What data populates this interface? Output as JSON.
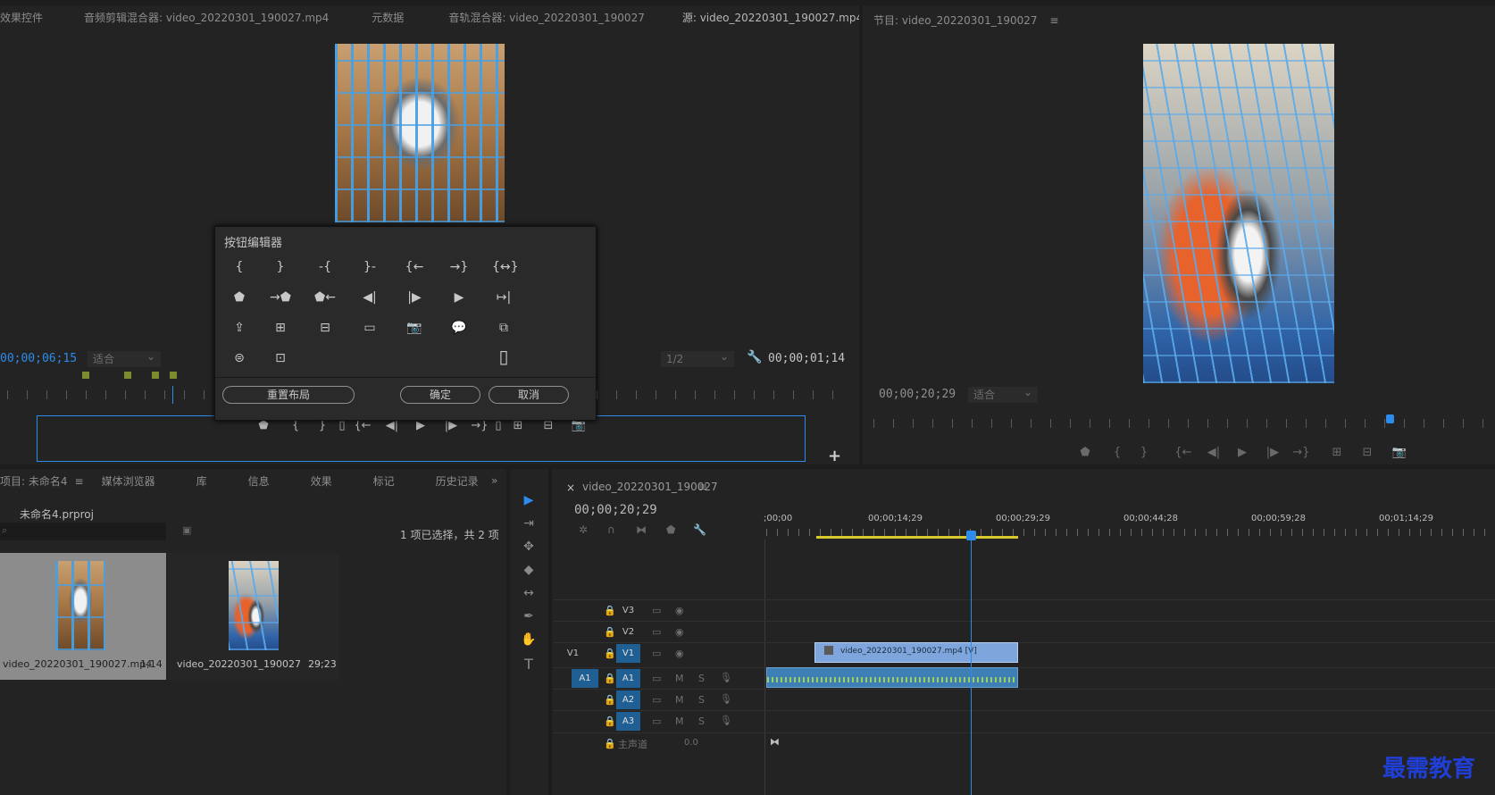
{
  "source_panel": {
    "tabs": [
      "效果控件",
      "音频剪辑混合器: video_20220301_190027.mp4",
      "元数据",
      "音轨混合器: video_20220301_190027",
      "源: video_20220301_190027.mp4"
    ],
    "menu_glyph": "≡",
    "timecode_left": "00;00;06;15",
    "fit_label": "适合",
    "quality_label": "1/2",
    "timecode_right": "00;00;01;14"
  },
  "program_panel": {
    "title": "节目: video_20220301_190027",
    "menu_glyph": "≡",
    "timecode": "00;00;20;29",
    "fit_label": "适合"
  },
  "button_editor": {
    "title": "按钮编辑器",
    "rows": [
      [
        "{",
        "}",
        "-{",
        "}-",
        "{←",
        "→}",
        "{↔}"
      ],
      [
        "⬟",
        "→⬟",
        "⬟←",
        "◀|",
        "|▶",
        "▶",
        "↦|"
      ],
      [
        "⇪",
        "⊞",
        "⊟",
        "▭",
        "📷",
        "💬",
        "⧉"
      ],
      [
        "⊜",
        "⊡",
        "",
        "",
        "",
        "",
        "▯"
      ]
    ],
    "reset_label": "重置布局",
    "ok_label": "确定",
    "cancel_label": "取消"
  },
  "source_controls": [
    "⬟",
    "{",
    "}",
    "▯",
    "{←",
    "◀|",
    "▶",
    "|▶",
    "→}",
    "▯",
    "⊞",
    "⊟",
    "📷"
  ],
  "program_controls": [
    "⬟",
    "{",
    "}",
    "{←",
    "◀|",
    "▶",
    "|▶",
    "→}",
    "⊞",
    "⊟",
    "📷"
  ],
  "add_button_glyph": "+",
  "project_panel": {
    "tabs": [
      "项目: 未命名4",
      "媒体浏览器",
      "库",
      "信息",
      "效果",
      "标记",
      "历史记录"
    ],
    "overflow_glyph": "»",
    "project_file": "未命名4.prproj",
    "selection_info": "1 项已选择，共 2 项",
    "items": [
      {
        "name": "video_20220301_190027.mp4",
        "duration": "1;14"
      },
      {
        "name": "video_20220301_190027",
        "duration": "29;23"
      }
    ]
  },
  "timeline": {
    "close_glyph": "×",
    "sequence_name": "video_20220301_190027",
    "menu_glyph": "≡",
    "timecode": "00;00;20;29",
    "ruler_labels": [
      ";00;00",
      "00;00;14;29",
      "00;00;29;29",
      "00;00;44;28",
      "00;00;59;28",
      "00;01;14;29"
    ],
    "video_tracks": [
      "V3",
      "V2",
      "V1"
    ],
    "audio_tracks": [
      "A1",
      "A2",
      "A3"
    ],
    "source_v": "V1",
    "source_a": "A1",
    "clip_label": "video_20220301_190027.mp4 [V]",
    "master_label": "主声道",
    "master_value": "0.0",
    "mute_label": "M",
    "solo_label": "S"
  },
  "tools": [
    "▶",
    "⇥",
    "✥",
    "◆",
    "↔",
    "✒",
    "✋",
    "T"
  ],
  "watermark": "最需教育",
  "colors": {
    "accent_blue": "#2d8ceb",
    "clip_video": "#7ea6dc",
    "clip_audio": "#3e7fb6",
    "work_area": "#d7c92c",
    "watermark": "#1f3fd6"
  }
}
